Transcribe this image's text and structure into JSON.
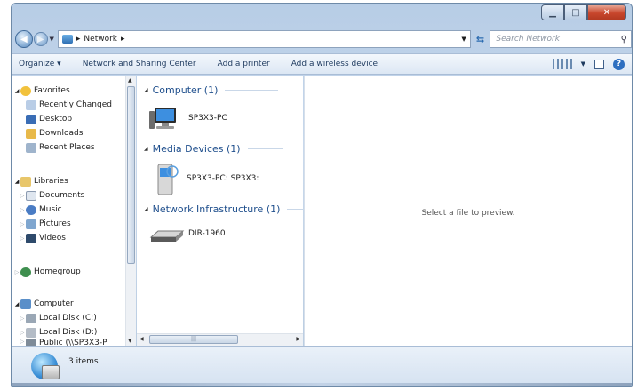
{
  "window": {
    "controls": {
      "minimize": "▁",
      "maximize": "□",
      "close": "✕"
    }
  },
  "address_bar": {
    "path_root": "▸",
    "location": "Network",
    "trailing_separator": "▸",
    "search_placeholder": "Search Network"
  },
  "command_bar": {
    "organize": "Organize ▾",
    "network_sharing": "Network and Sharing Center",
    "add_printer": "Add a printer",
    "add_wireless": "Add a wireless device"
  },
  "nav_pane": {
    "favorites": {
      "label": "Favorites",
      "items": [
        "Recently Changed",
        "Desktop",
        "Downloads",
        "Recent Places"
      ]
    },
    "libraries": {
      "label": "Libraries",
      "items": [
        "Documents",
        "Music",
        "Pictures",
        "Videos"
      ]
    },
    "homegroup": "Homegroup",
    "computer": {
      "label": "Computer",
      "items": [
        "Local Disk (C:)",
        "Local Disk (D:)",
        "Public (\\\\SP3X3-P"
      ]
    }
  },
  "groups": [
    {
      "header": "Computer (1)",
      "items": [
        {
          "label": "SP3X3-PC",
          "icon": "computer-icon"
        }
      ]
    },
    {
      "header": "Media Devices (1)",
      "items": [
        {
          "label": "SP3X3-PC: SP3X3:",
          "icon": "media-device-icon"
        }
      ]
    },
    {
      "header": "Network Infrastructure (1)",
      "items": [
        {
          "label": "DIR-1960",
          "icon": "router-icon"
        }
      ]
    }
  ],
  "preview_pane": {
    "message": "Select a file to preview."
  },
  "details_pane": {
    "item_count": "3 items"
  },
  "colors": {
    "accent": "#1e4e8c",
    "frame": "#b7cde6",
    "close_button": "#c8462c"
  }
}
